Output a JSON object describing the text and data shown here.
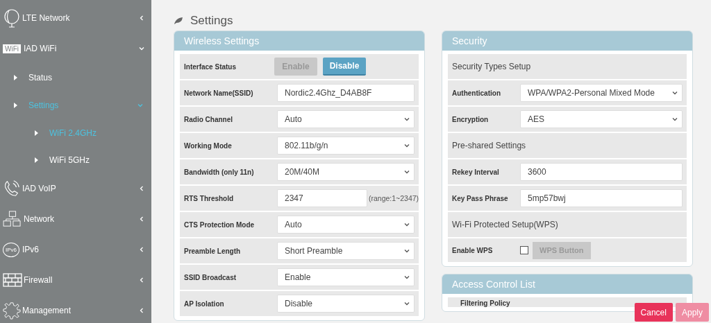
{
  "sidebar": {
    "items": [
      {
        "label": "LTE Network",
        "expanded": false
      },
      {
        "label": "IAD WiFi",
        "icon_text": "WiFi",
        "expanded": true,
        "children": [
          {
            "label": "Status",
            "selected": false
          },
          {
            "label": "Settings",
            "selected": true,
            "expanded": true,
            "children": [
              {
                "label": "WiFi 2.4GHz",
                "selected": true
              },
              {
                "label": "WiFi 5GHz",
                "selected": false
              }
            ]
          }
        ]
      },
      {
        "label": "IAD VoIP",
        "expanded": false
      },
      {
        "label": "Network",
        "expanded": false
      },
      {
        "label": "IPv6",
        "icon_text": "IPv6",
        "expanded": false
      },
      {
        "label": "Firewall",
        "expanded": false
      },
      {
        "label": "Management",
        "expanded": false
      }
    ]
  },
  "page": {
    "title": "Settings"
  },
  "wireless_settings": {
    "title": "Wireless Settings",
    "rows": [
      {
        "kind": "toggle",
        "label": "Interface Status",
        "options": [
          {
            "label": "Enable",
            "selected": false
          },
          {
            "label": "Disable",
            "selected": true
          }
        ]
      },
      {
        "kind": "text",
        "label": "Network Name(SSID)",
        "value": "Nordic2.4Ghz_D4AB8F"
      },
      {
        "kind": "select",
        "label": "Radio Channel",
        "value": "Auto"
      },
      {
        "kind": "select",
        "label": "Working Mode",
        "value": "802.11b/g/n"
      },
      {
        "kind": "select",
        "label": "Bandwidth (only 11n)",
        "value": "20M/40M"
      },
      {
        "kind": "text_hint",
        "label": "RTS Threshold",
        "value": "2347",
        "hint": "(range:1~2347)"
      },
      {
        "kind": "select",
        "label": "CTS Protection Mode",
        "value": "Auto"
      },
      {
        "kind": "select",
        "label": "Preamble Length",
        "value": "Short Preamble"
      },
      {
        "kind": "select",
        "label": "SSID Broadcast",
        "value": "Enable"
      },
      {
        "kind": "select",
        "label": "AP Isolation",
        "value": "Disable"
      }
    ]
  },
  "security": {
    "title": "Security",
    "rows": [
      {
        "kind": "section",
        "label": "Security Types Setup"
      },
      {
        "kind": "select",
        "label": "Authentication",
        "value": "WPA/WPA2-Personal Mixed Mode"
      },
      {
        "kind": "select",
        "label": "Encryption",
        "value": "AES"
      },
      {
        "kind": "section",
        "label": "Pre-shared Settings"
      },
      {
        "kind": "text",
        "label": "Rekey Interval",
        "value": "3600"
      },
      {
        "kind": "text",
        "label": "Key Pass Phrase",
        "value": "5mp57bwj"
      },
      {
        "kind": "section",
        "label": "Wi-Fi Protected Setup(WPS)"
      },
      {
        "kind": "checkbox_button",
        "label": "Enable WPS",
        "checked": false,
        "button": "WPS Button"
      }
    ]
  },
  "access_control": {
    "title": "Access Control List",
    "rows": [
      {
        "kind": "label",
        "label": "Filtering Policy"
      }
    ]
  },
  "actions": [
    {
      "label": "Cancel",
      "disabled": false
    },
    {
      "label": "Apply",
      "disabled": true
    }
  ]
}
